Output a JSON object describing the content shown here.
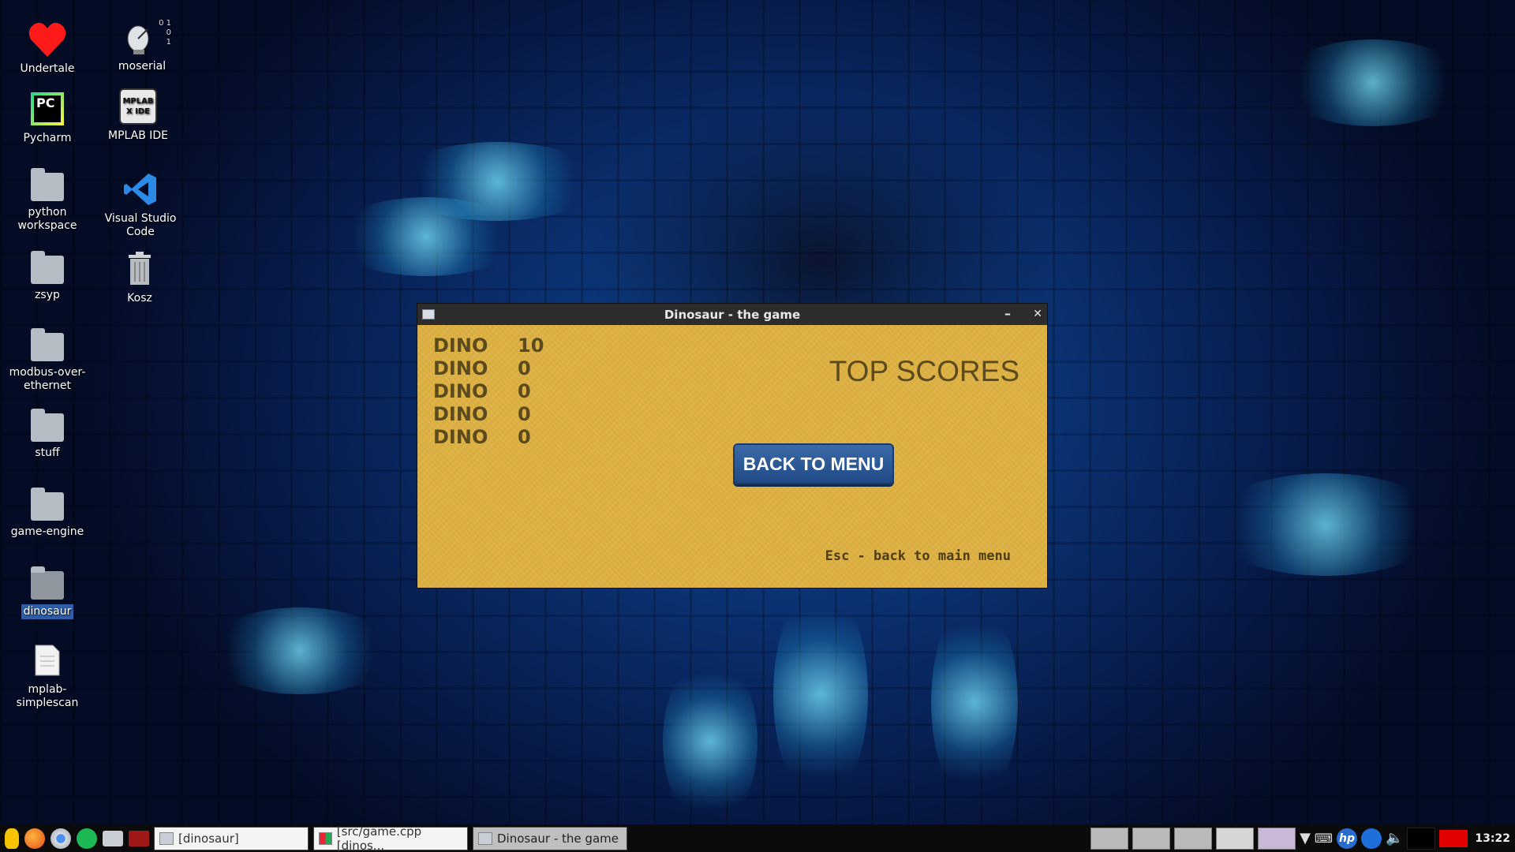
{
  "desktop": {
    "icons": [
      {
        "label": "Undertale"
      },
      {
        "label": "moserial"
      },
      {
        "label": "Pycharm"
      },
      {
        "label": "MPLAB IDE"
      },
      {
        "label": "python workspace"
      },
      {
        "label": "Visual Studio Code"
      },
      {
        "label": "zsyp"
      },
      {
        "label": "Kosz"
      },
      {
        "label": "modbus-over-ethernet"
      },
      {
        "label": "stuff"
      },
      {
        "label": "game-engine"
      },
      {
        "label": "dinosaur"
      },
      {
        "label": "mplab-simplescan"
      }
    ],
    "moserial_digits": "0 1\n0\n1",
    "pycharm_text": "PC",
    "mplab_text": "MPLAB X IDE"
  },
  "window": {
    "title": "Dinosaur - the game",
    "minimize": "–",
    "close": "✕"
  },
  "game": {
    "scores": [
      {
        "name": "DINO",
        "score": "10"
      },
      {
        "name": "DINO",
        "score": "0"
      },
      {
        "name": "DINO",
        "score": "0"
      },
      {
        "name": "DINO",
        "score": "0"
      },
      {
        "name": "DINO",
        "score": "0"
      }
    ],
    "title": "TOP SCORES",
    "back_button": "BACK TO MENU",
    "hint": "Esc - back to main menu"
  },
  "taskbar": {
    "tasks": [
      {
        "label": "[dinosaur]"
      },
      {
        "label": "[src/game.cpp [dinos..."
      },
      {
        "label": "Dinosaur - the game"
      }
    ],
    "clock": "13:22",
    "hp_text": "hp"
  },
  "colors": {
    "game_bg": "#dcb043",
    "game_text": "#5b4a1e",
    "button": "#2a5594"
  }
}
